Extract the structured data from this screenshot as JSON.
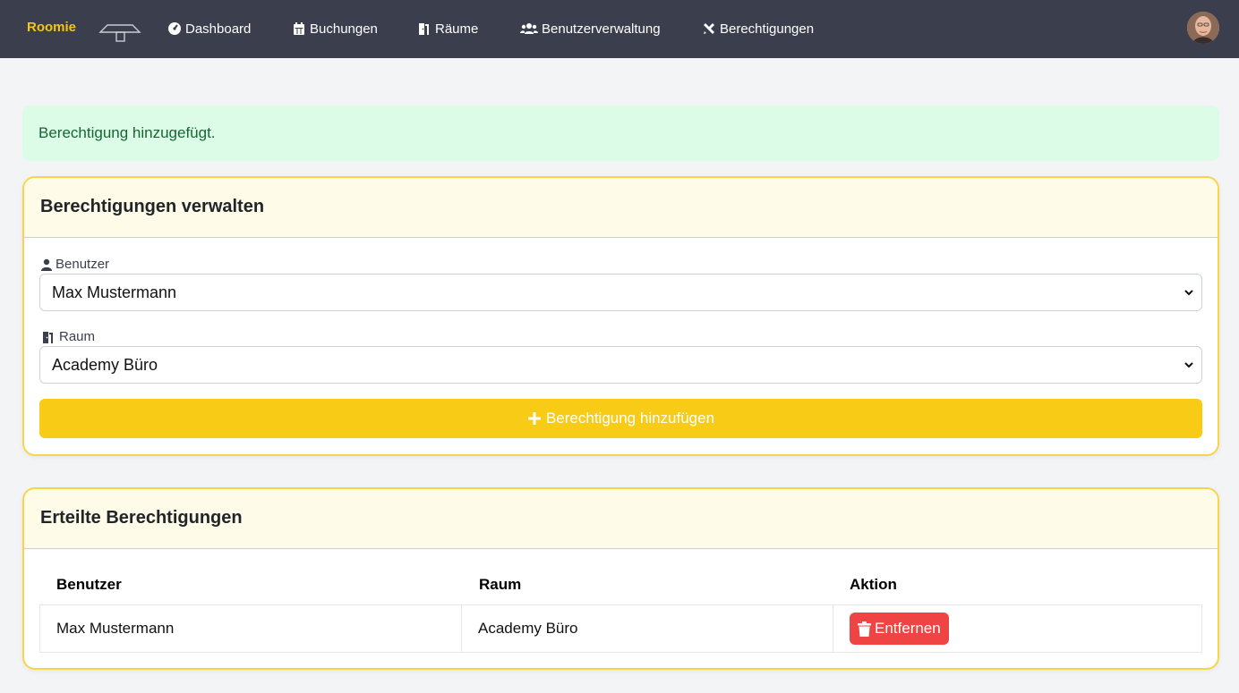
{
  "navbar": {
    "brand": "Roomie",
    "items": [
      {
        "label": "Dashboard",
        "icon": "gauge-icon"
      },
      {
        "label": "Buchungen",
        "icon": "calendar-icon"
      },
      {
        "label": "Räume",
        "icon": "door-icon"
      },
      {
        "label": "Benutzerverwaltung",
        "icon": "users-icon"
      },
      {
        "label": "Berechtigungen",
        "icon": "tools-icon"
      }
    ]
  },
  "alert": {
    "message": "Berechtigung hinzugefügt."
  },
  "manage": {
    "title": "Berechtigungen verwalten",
    "user_label": "Benutzer",
    "user_value": "Max Mustermann",
    "room_label": "Raum",
    "room_value": "Academy Büro",
    "add_button": "Berechtigung hinzufügen"
  },
  "granted": {
    "title": "Erteilte Berechtigungen",
    "columns": [
      "Benutzer",
      "Raum",
      "Aktion"
    ],
    "rows": [
      {
        "user": "Max Mustermann",
        "room": "Academy Büro",
        "action": "Entfernen"
      }
    ]
  },
  "colors": {
    "navbar": "#3b3e4d",
    "brand": "#f5c518",
    "accent": "#f8cb17",
    "danger": "#ef4444",
    "success_bg": "#dcfce7"
  }
}
